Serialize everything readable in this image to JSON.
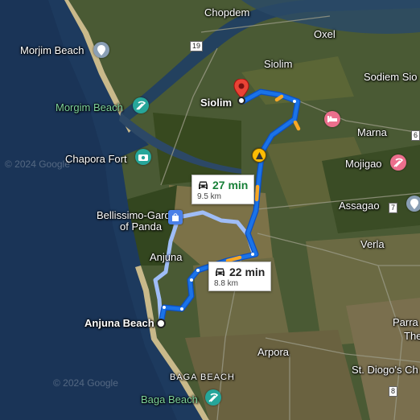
{
  "places": {
    "chopdem": "Chopdem",
    "oxel": "Oxel",
    "siolim_town": "Siolim",
    "sodiem": "Sodiem Sio",
    "morjim_beach": "Morjim Beach",
    "morgim_beach": "Morgim Beach",
    "marna": "Marna",
    "chapora_fort": "Chapora Fort",
    "mojigao": "Mojigao",
    "assagao": "Assagao",
    "bellissimo": "Bellissimo-Garden",
    "bellissimo2": "of Panda",
    "verla": "Verla",
    "anjuna": "Anjuna",
    "parra": "Parra",
    "parra2": "The",
    "arpora": "Arpora",
    "baga_beach_area": "BAGA BEACH",
    "st_diogo": "St. Diogo's Ch",
    "baga_beach": "Baga Beach"
  },
  "route": {
    "origin": "Anjuna Beach",
    "destination": "Siolim"
  },
  "eta_primary": {
    "time": "22 min",
    "distance": "8.8 km",
    "mode": "car-icon"
  },
  "eta_alternate": {
    "time": "27 min",
    "distance": "9.5 km",
    "mode": "car-icon"
  },
  "road_shields": {
    "r19": "19",
    "r7": "7",
    "r6": "6",
    "r8": "8"
  },
  "watermarks": {
    "w1": "© 2024 Google",
    "w2": "© 2024 Google"
  },
  "colors": {
    "route_primary": "#1a73e8",
    "route_alternate": "#9fbdf7",
    "traffic_slow": "#f9a825",
    "destination_pin": "#ea4335",
    "attraction_pin": "#26a69a",
    "spa_pin": "#ec6f8d"
  }
}
